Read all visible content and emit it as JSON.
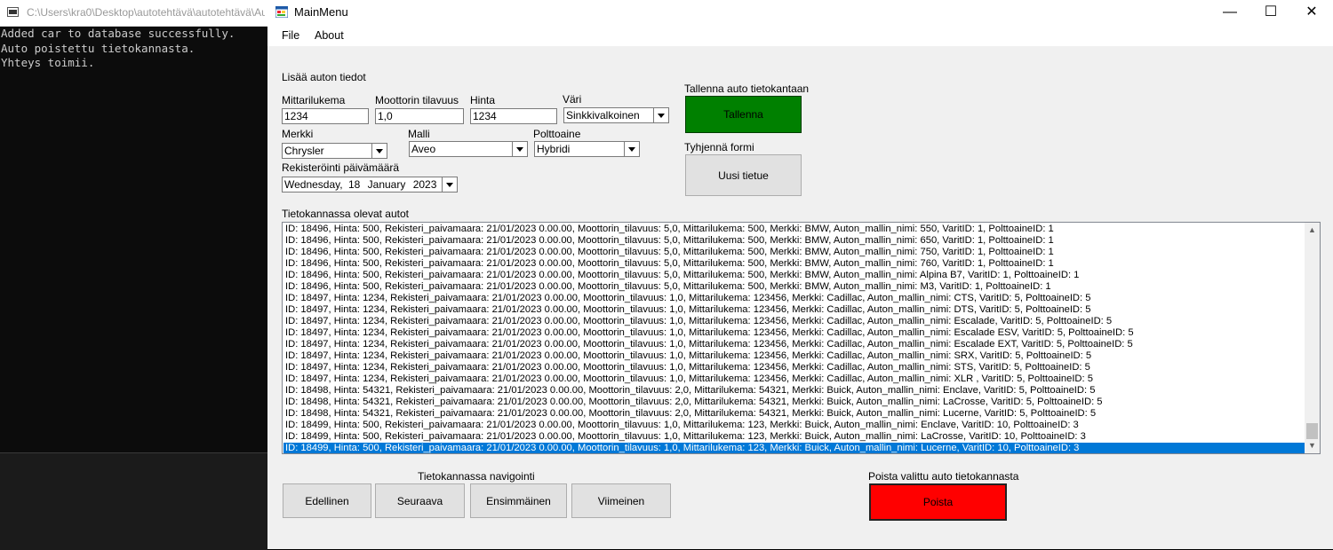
{
  "console": {
    "title": "C:\\Users\\kra0\\Desktop\\autotehtävä\\autotehtävä\\Au",
    "lines": [
      "Added car to database successfully.",
      "Auto poistettu tietokannasta.",
      "Yhteys toimii."
    ]
  },
  "window": {
    "title": "MainMenu",
    "minimize_glyph": "—",
    "maximize_glyph": "☐",
    "close_glyph": "✕"
  },
  "menu": {
    "file": "File",
    "about": "About"
  },
  "form": {
    "section_title": "Lisää auton tiedot",
    "mittarilukema": {
      "label": "Mittarilukema",
      "value": "1234"
    },
    "moottorin_tilavuus": {
      "label": "Moottorin tilavuus",
      "value": "1,0"
    },
    "hinta": {
      "label": "Hinta",
      "value": "1234"
    },
    "vari": {
      "label": "Väri",
      "value": "Sinkkivalkoinen"
    },
    "merkki": {
      "label": "Merkki",
      "value": "Chrysler"
    },
    "malli": {
      "label": "Malli",
      "value": "Aveo"
    },
    "polttoaine": {
      "label": "Polttoaine",
      "value": "Hybridi"
    },
    "rekisterointi": {
      "label": "Rekisteröinti päivämäärä",
      "weekday": "Wednesday,",
      "day": "18",
      "month": "January",
      "year": "2023"
    }
  },
  "save": {
    "label": "Tallenna auto tietokantaan",
    "button": "Tallenna",
    "color": "#008000"
  },
  "clear": {
    "label": "Tyhjennä formi",
    "button": "Uusi tietue"
  },
  "list": {
    "title": "Tietokannassa olevat autot",
    "selected_index": 19,
    "selected_color": "#0078d7",
    "rows": [
      "ID: 18496, Hinta: 500, Rekisteri_paivamaara: 21/01/2023 0.00.00, Moottorin_tilavuus: 5,0, Mittarilukema: 500, Merkki: BMW, Auton_mallin_nimi: 550, VaritID: 1, PolttoaineID: 1",
      "ID: 18496, Hinta: 500, Rekisteri_paivamaara: 21/01/2023 0.00.00, Moottorin_tilavuus: 5,0, Mittarilukema: 500, Merkki: BMW, Auton_mallin_nimi: 650, VaritID: 1, PolttoaineID: 1",
      "ID: 18496, Hinta: 500, Rekisteri_paivamaara: 21/01/2023 0.00.00, Moottorin_tilavuus: 5,0, Mittarilukema: 500, Merkki: BMW, Auton_mallin_nimi: 750, VaritID: 1, PolttoaineID: 1",
      "ID: 18496, Hinta: 500, Rekisteri_paivamaara: 21/01/2023 0.00.00, Moottorin_tilavuus: 5,0, Mittarilukema: 500, Merkki: BMW, Auton_mallin_nimi: 760, VaritID: 1, PolttoaineID: 1",
      "ID: 18496, Hinta: 500, Rekisteri_paivamaara: 21/01/2023 0.00.00, Moottorin_tilavuus: 5,0, Mittarilukema: 500, Merkki: BMW, Auton_mallin_nimi: Alpina B7, VaritID: 1, PolttoaineID: 1",
      "ID: 18496, Hinta: 500, Rekisteri_paivamaara: 21/01/2023 0.00.00, Moottorin_tilavuus: 5,0, Mittarilukema: 500, Merkki: BMW, Auton_mallin_nimi: M3, VaritID: 1, PolttoaineID: 1",
      "ID: 18497, Hinta: 1234, Rekisteri_paivamaara: 21/01/2023 0.00.00, Moottorin_tilavuus: 1,0, Mittarilukema: 123456, Merkki: Cadillac, Auton_mallin_nimi: CTS, VaritID: 5, PolttoaineID: 5",
      "ID: 18497, Hinta: 1234, Rekisteri_paivamaara: 21/01/2023 0.00.00, Moottorin_tilavuus: 1,0, Mittarilukema: 123456, Merkki: Cadillac, Auton_mallin_nimi: DTS, VaritID: 5, PolttoaineID: 5",
      "ID: 18497, Hinta: 1234, Rekisteri_paivamaara: 21/01/2023 0.00.00, Moottorin_tilavuus: 1,0, Mittarilukema: 123456, Merkki: Cadillac, Auton_mallin_nimi: Escalade, VaritID: 5, PolttoaineID: 5",
      "ID: 18497, Hinta: 1234, Rekisteri_paivamaara: 21/01/2023 0.00.00, Moottorin_tilavuus: 1,0, Mittarilukema: 123456, Merkki: Cadillac, Auton_mallin_nimi: Escalade ESV, VaritID: 5, PolttoaineID: 5",
      "ID: 18497, Hinta: 1234, Rekisteri_paivamaara: 21/01/2023 0.00.00, Moottorin_tilavuus: 1,0, Mittarilukema: 123456, Merkki: Cadillac, Auton_mallin_nimi: Escalade EXT, VaritID: 5, PolttoaineID: 5",
      "ID: 18497, Hinta: 1234, Rekisteri_paivamaara: 21/01/2023 0.00.00, Moottorin_tilavuus: 1,0, Mittarilukema: 123456, Merkki: Cadillac, Auton_mallin_nimi: SRX, VaritID: 5, PolttoaineID: 5",
      "ID: 18497, Hinta: 1234, Rekisteri_paivamaara: 21/01/2023 0.00.00, Moottorin_tilavuus: 1,0, Mittarilukema: 123456, Merkki: Cadillac, Auton_mallin_nimi: STS, VaritID: 5, PolttoaineID: 5",
      "ID: 18497, Hinta: 1234, Rekisteri_paivamaara: 21/01/2023 0.00.00, Moottorin_tilavuus: 1,0, Mittarilukema: 123456, Merkki: Cadillac, Auton_mallin_nimi: XLR , VaritID: 5, PolttoaineID: 5",
      "ID: 18498, Hinta: 54321, Rekisteri_paivamaara: 21/01/2023 0.00.00, Moottorin_tilavuus: 2,0, Mittarilukema: 54321, Merkki: Buick, Auton_mallin_nimi: Enclave, VaritID: 5, PolttoaineID: 5",
      "ID: 18498, Hinta: 54321, Rekisteri_paivamaara: 21/01/2023 0.00.00, Moottorin_tilavuus: 2,0, Mittarilukema: 54321, Merkki: Buick, Auton_mallin_nimi: LaCrosse, VaritID: 5, PolttoaineID: 5",
      "ID: 18498, Hinta: 54321, Rekisteri_paivamaara: 21/01/2023 0.00.00, Moottorin_tilavuus: 2,0, Mittarilukema: 54321, Merkki: Buick, Auton_mallin_nimi: Lucerne, VaritID: 5, PolttoaineID: 5",
      "ID: 18499, Hinta: 500, Rekisteri_paivamaara: 21/01/2023 0.00.00, Moottorin_tilavuus: 1,0, Mittarilukema: 123, Merkki: Buick, Auton_mallin_nimi: Enclave, VaritID: 10, PolttoaineID: 3",
      "ID: 18499, Hinta: 500, Rekisteri_paivamaara: 21/01/2023 0.00.00, Moottorin_tilavuus: 1,0, Mittarilukema: 123, Merkki: Buick, Auton_mallin_nimi: LaCrosse, VaritID: 10, PolttoaineID: 3",
      "ID: 18499, Hinta: 500, Rekisteri_paivamaara: 21/01/2023 0.00.00, Moottorin_tilavuus: 1,0, Mittarilukema: 123, Merkki: Buick, Auton_mallin_nimi: Lucerne, VaritID: 10, PolttoaineID: 3"
    ]
  },
  "nav": {
    "label": "Tietokannassa navigointi",
    "prev": "Edellinen",
    "next": "Seuraava",
    "first": "Ensimmäinen",
    "last": "Viimeinen"
  },
  "delete": {
    "label": "Poista valittu auto tietokannasta",
    "button": "Poista",
    "color": "#ff0000"
  }
}
